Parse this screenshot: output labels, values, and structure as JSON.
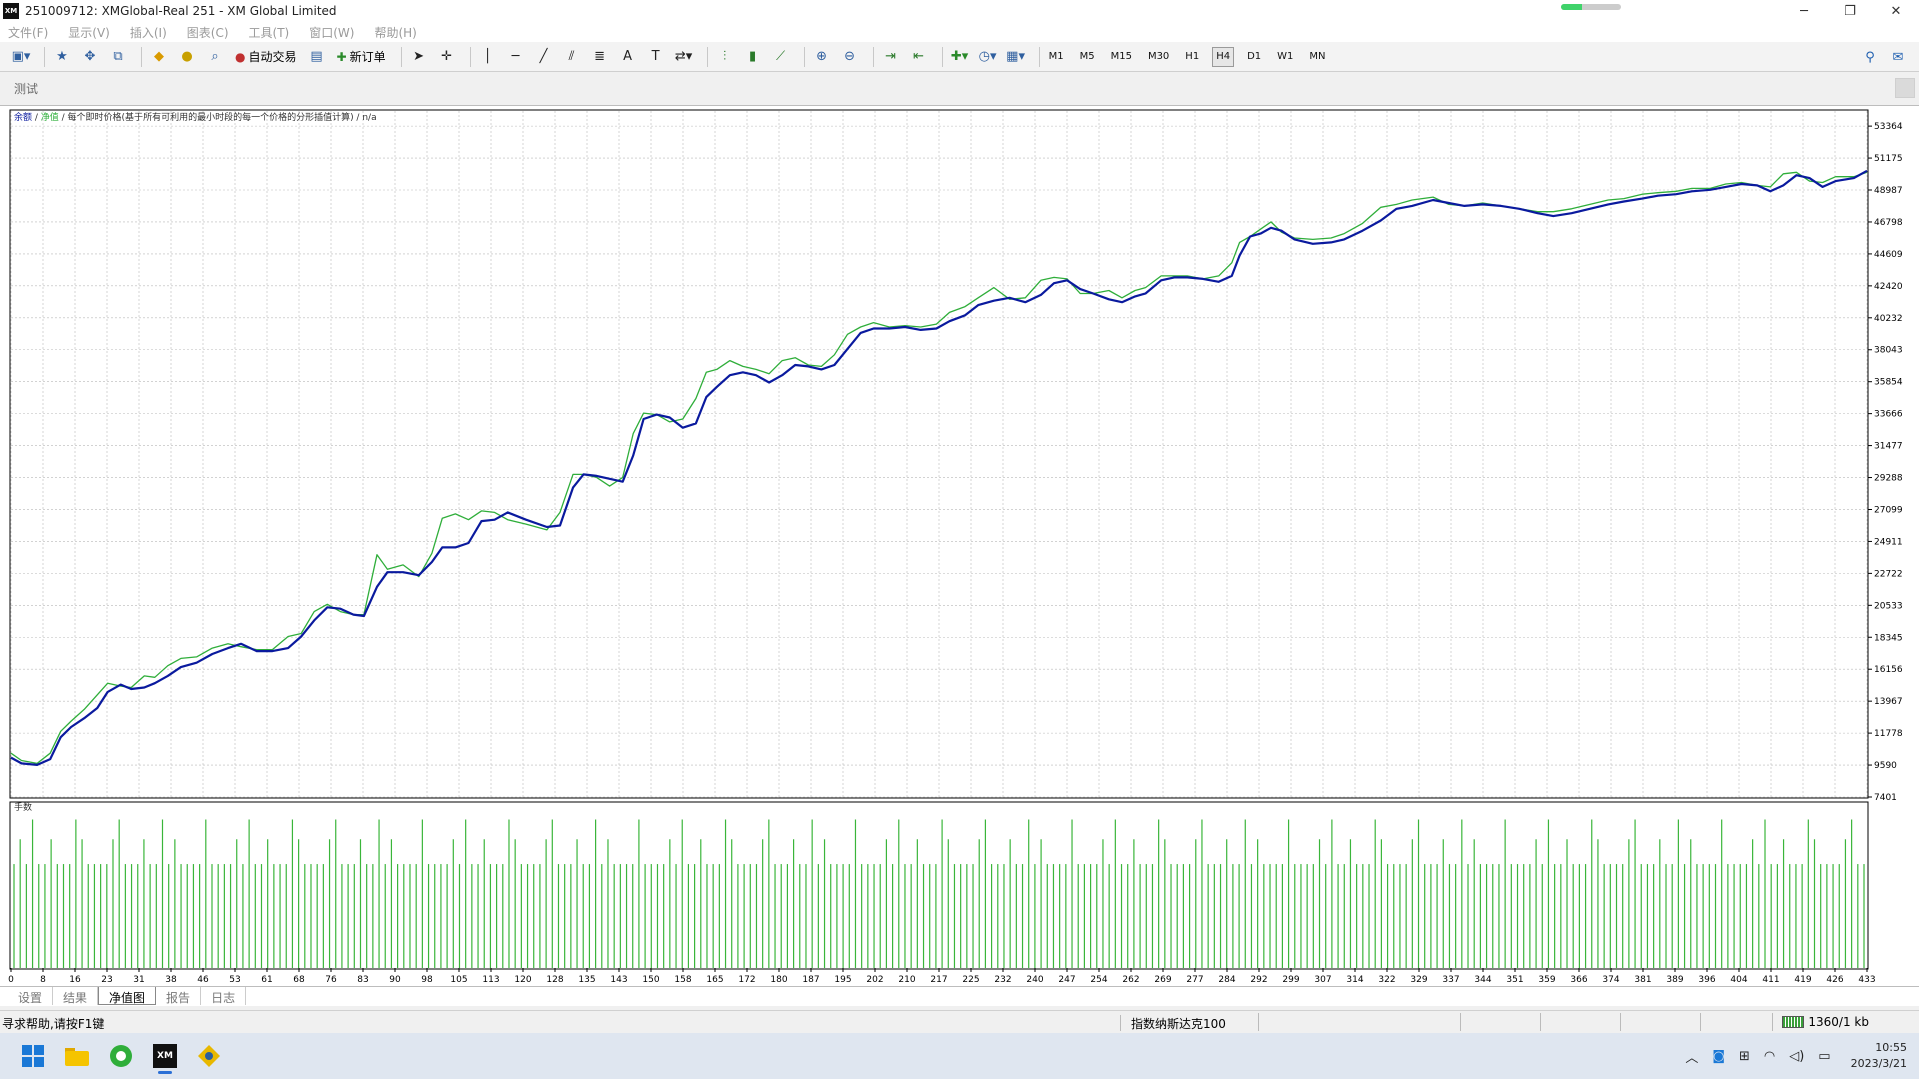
{
  "window": {
    "title": "251009712: XMGlobal-Real 251 - XM Global Limited",
    "logo": "XM",
    "progress_fraction": 0.35,
    "minimize": "─",
    "maximize": "❐",
    "close": "✕"
  },
  "menu": [
    "文件(F)",
    "显示(V)",
    "插入(I)",
    "图表(C)",
    "工具(T)",
    "窗口(W)",
    "帮助(H)"
  ],
  "toolbar": {
    "auto_trade_label": "自动交易",
    "new_order_label": "新订单",
    "timeframes": [
      "M1",
      "M5",
      "M15",
      "M30",
      "H1",
      "H4",
      "D1",
      "W1",
      "MN"
    ],
    "active_timeframe": "H4"
  },
  "panel": {
    "title": "测试"
  },
  "chart_legend": {
    "balance": "余额",
    "sep1": " / ",
    "equity": "净值",
    "rest": " / 每个即时价格(基于所有可利用的最小时段的每一个价格的分形插值计算) / n/a"
  },
  "chart_data": {
    "type": "line",
    "series": [
      {
        "name": "余额",
        "color": "#0a1a9e",
        "points": [
          [
            0,
            10100
          ],
          [
            4,
            9700
          ],
          [
            10,
            9600
          ],
          [
            15,
            10000
          ],
          [
            19,
            11500
          ],
          [
            23,
            12200
          ],
          [
            28,
            12800
          ],
          [
            33,
            13500
          ],
          [
            37,
            14600
          ],
          [
            42,
            15100
          ],
          [
            46,
            14800
          ],
          [
            51,
            14900
          ],
          [
            55,
            15200
          ],
          [
            60,
            15700
          ],
          [
            65,
            16300
          ],
          [
            71,
            16600
          ],
          [
            77,
            17200
          ],
          [
            83,
            17600
          ],
          [
            88,
            17900
          ],
          [
            94,
            17400
          ],
          [
            100,
            17400
          ],
          [
            106,
            17600
          ],
          [
            111,
            18400
          ],
          [
            116,
            19500
          ],
          [
            121,
            20400
          ],
          [
            126,
            20300
          ],
          [
            131,
            19900
          ],
          [
            135,
            19800
          ],
          [
            140,
            21800
          ],
          [
            144,
            22800
          ],
          [
            150,
            22800
          ],
          [
            156,
            22600
          ],
          [
            161,
            23500
          ],
          [
            165,
            24500
          ],
          [
            170,
            24500
          ],
          [
            175,
            24800
          ],
          [
            180,
            26300
          ],
          [
            185,
            26400
          ],
          [
            190,
            26900
          ],
          [
            197,
            26400
          ],
          [
            205,
            25900
          ],
          [
            210,
            26000
          ],
          [
            215,
            28600
          ],
          [
            219,
            29500
          ],
          [
            224,
            29400
          ],
          [
            229,
            29200
          ],
          [
            234,
            29000
          ],
          [
            238,
            30800
          ],
          [
            242,
            33300
          ],
          [
            247,
            33600
          ],
          [
            252,
            33400
          ],
          [
            257,
            32700
          ],
          [
            262,
            33000
          ],
          [
            266,
            34800
          ],
          [
            270,
            35500
          ],
          [
            275,
            36300
          ],
          [
            280,
            36500
          ],
          [
            285,
            36300
          ],
          [
            290,
            35800
          ],
          [
            295,
            36300
          ],
          [
            300,
            37000
          ],
          [
            305,
            36900
          ],
          [
            310,
            36700
          ],
          [
            315,
            37000
          ],
          [
            320,
            38100
          ],
          [
            325,
            39200
          ],
          [
            330,
            39500
          ],
          [
            336,
            39500
          ],
          [
            342,
            39600
          ],
          [
            348,
            39400
          ],
          [
            354,
            39500
          ],
          [
            359,
            40000
          ],
          [
            365,
            40400
          ],
          [
            370,
            41100
          ],
          [
            376,
            41400
          ],
          [
            382,
            41600
          ],
          [
            388,
            41300
          ],
          [
            394,
            41800
          ],
          [
            399,
            42600
          ],
          [
            404,
            42800
          ],
          [
            409,
            42200
          ],
          [
            414,
            41900
          ],
          [
            420,
            41500
          ],
          [
            425,
            41300
          ],
          [
            430,
            41700
          ],
          [
            434,
            41900
          ],
          [
            440,
            42800
          ],
          [
            445,
            43000
          ],
          [
            450,
            43000
          ],
          [
            456,
            42900
          ],
          [
            462,
            42700
          ],
          [
            467,
            43100
          ],
          [
            470,
            44500
          ],
          [
            474,
            45800
          ],
          [
            478,
            46000
          ],
          [
            482,
            46400
          ],
          [
            486,
            46200
          ],
          [
            491,
            45600
          ],
          [
            498,
            45300
          ],
          [
            505,
            45400
          ],
          [
            510,
            45600
          ],
          [
            517,
            46200
          ],
          [
            524,
            46900
          ],
          [
            530,
            47700
          ],
          [
            536,
            47900
          ],
          [
            544,
            48300
          ],
          [
            550,
            48100
          ],
          [
            556,
            47900
          ],
          [
            563,
            48000
          ],
          [
            570,
            47900
          ],
          [
            577,
            47700
          ],
          [
            584,
            47400
          ],
          [
            590,
            47200
          ],
          [
            597,
            47400
          ],
          [
            604,
            47700
          ],
          [
            611,
            48000
          ],
          [
            617,
            48200
          ],
          [
            624,
            48400
          ],
          [
            630,
            48600
          ],
          [
            637,
            48700
          ],
          [
            643,
            48900
          ],
          [
            650,
            49000
          ],
          [
            656,
            49200
          ],
          [
            662,
            49400
          ],
          [
            668,
            49300
          ],
          [
            673,
            48900
          ],
          [
            678,
            49300
          ],
          [
            683,
            50000
          ],
          [
            688,
            49800
          ],
          [
            693,
            49200
          ],
          [
            698,
            49600
          ],
          [
            705,
            49800
          ],
          [
            710,
            50300
          ]
        ]
      },
      {
        "name": "净值",
        "color": "#2fae3a",
        "points": [
          [
            0,
            10400
          ],
          [
            4,
            9900
          ],
          [
            10,
            9700
          ],
          [
            15,
            10400
          ],
          [
            19,
            11900
          ],
          [
            23,
            12600
          ],
          [
            28,
            13400
          ],
          [
            33,
            14400
          ],
          [
            37,
            15200
          ],
          [
            42,
            15000
          ],
          [
            46,
            14900
          ],
          [
            51,
            15700
          ],
          [
            55,
            15600
          ],
          [
            60,
            16400
          ],
          [
            65,
            16900
          ],
          [
            71,
            17000
          ],
          [
            77,
            17600
          ],
          [
            83,
            17900
          ],
          [
            88,
            17700
          ],
          [
            94,
            17500
          ],
          [
            100,
            17500
          ],
          [
            106,
            18400
          ],
          [
            111,
            18600
          ],
          [
            116,
            20100
          ],
          [
            121,
            20600
          ],
          [
            126,
            20100
          ],
          [
            131,
            19900
          ],
          [
            135,
            19900
          ],
          [
            140,
            24000
          ],
          [
            144,
            23000
          ],
          [
            150,
            23300
          ],
          [
            156,
            22500
          ],
          [
            161,
            24100
          ],
          [
            165,
            26500
          ],
          [
            170,
            26800
          ],
          [
            175,
            26400
          ],
          [
            180,
            27000
          ],
          [
            185,
            26900
          ],
          [
            190,
            26400
          ],
          [
            197,
            26100
          ],
          [
            205,
            25700
          ],
          [
            210,
            26900
          ],
          [
            215,
            29500
          ],
          [
            219,
            29500
          ],
          [
            224,
            29300
          ],
          [
            229,
            28700
          ],
          [
            234,
            29300
          ],
          [
            238,
            32300
          ],
          [
            242,
            33700
          ],
          [
            247,
            33600
          ],
          [
            252,
            33100
          ],
          [
            257,
            33300
          ],
          [
            262,
            34700
          ],
          [
            266,
            36500
          ],
          [
            270,
            36700
          ],
          [
            275,
            37300
          ],
          [
            280,
            36900
          ],
          [
            285,
            36700
          ],
          [
            290,
            36400
          ],
          [
            295,
            37300
          ],
          [
            300,
            37500
          ],
          [
            305,
            37000
          ],
          [
            310,
            36900
          ],
          [
            315,
            37700
          ],
          [
            320,
            39100
          ],
          [
            325,
            39600
          ],
          [
            330,
            39900
          ],
          [
            336,
            39600
          ],
          [
            342,
            39700
          ],
          [
            348,
            39600
          ],
          [
            354,
            39800
          ],
          [
            359,
            40600
          ],
          [
            365,
            41000
          ],
          [
            370,
            41600
          ],
          [
            376,
            42300
          ],
          [
            382,
            41500
          ],
          [
            388,
            41600
          ],
          [
            394,
            42800
          ],
          [
            399,
            43000
          ],
          [
            404,
            42900
          ],
          [
            409,
            41900
          ],
          [
            414,
            41900
          ],
          [
            420,
            42100
          ],
          [
            425,
            41600
          ],
          [
            430,
            42100
          ],
          [
            434,
            42300
          ],
          [
            440,
            43100
          ],
          [
            445,
            43100
          ],
          [
            450,
            43100
          ],
          [
            456,
            42900
          ],
          [
            462,
            43100
          ],
          [
            467,
            44000
          ],
          [
            470,
            45400
          ],
          [
            474,
            45800
          ],
          [
            478,
            46300
          ],
          [
            482,
            46800
          ],
          [
            486,
            46100
          ],
          [
            491,
            45700
          ],
          [
            498,
            45600
          ],
          [
            505,
            45700
          ],
          [
            510,
            46000
          ],
          [
            517,
            46700
          ],
          [
            524,
            47800
          ],
          [
            530,
            48000
          ],
          [
            536,
            48300
          ],
          [
            544,
            48500
          ],
          [
            550,
            48000
          ],
          [
            556,
            47900
          ],
          [
            563,
            48100
          ],
          [
            570,
            47900
          ],
          [
            577,
            47700
          ],
          [
            584,
            47500
          ],
          [
            590,
            47500
          ],
          [
            597,
            47700
          ],
          [
            604,
            48000
          ],
          [
            611,
            48300
          ],
          [
            617,
            48400
          ],
          [
            624,
            48700
          ],
          [
            630,
            48800
          ],
          [
            637,
            48900
          ],
          [
            643,
            49100
          ],
          [
            650,
            49100
          ],
          [
            656,
            49400
          ],
          [
            662,
            49500
          ],
          [
            668,
            49300
          ],
          [
            673,
            49200
          ],
          [
            678,
            50100
          ],
          [
            683,
            50200
          ],
          [
            688,
            49600
          ],
          [
            693,
            49500
          ],
          [
            698,
            49900
          ],
          [
            705,
            49900
          ],
          [
            710,
            50200
          ]
        ]
      }
    ],
    "x_range": [
      0,
      710
    ],
    "x_tick_labels": [
      "0",
      "8",
      "16",
      "23",
      "31",
      "38",
      "46",
      "53",
      "61",
      "68",
      "76",
      "83",
      "90",
      "98",
      "105",
      "113",
      "120",
      "128",
      "135",
      "143",
      "150",
      "158",
      "165",
      "172",
      "180",
      "187",
      "195",
      "202",
      "210",
      "217",
      "225",
      "232",
      "240",
      "247",
      "254",
      "262",
      "269",
      "277",
      "284",
      "292",
      "299",
      "307",
      "314",
      "322",
      "329",
      "337",
      "344",
      "351",
      "359",
      "366",
      "374",
      "381",
      "389",
      "396",
      "404",
      "411",
      "419",
      "426",
      "433"
    ],
    "y_range": [
      7401,
      54400
    ],
    "y_tick_values": [
      53364,
      51175,
      48987,
      46798,
      44609,
      42420,
      40232,
      38043,
      35854,
      33666,
      31477,
      29288,
      27099,
      24911,
      22722,
      20533,
      18345,
      16156,
      13967,
      11778,
      9590,
      7401
    ],
    "grid": true,
    "volume_panel": {
      "label": "手数",
      "color": "#3ab53a",
      "bar_count": 300,
      "tall_level": 0.9,
      "high_level": 0.78,
      "normal_level": 0.63,
      "tall_every": 7,
      "high_every": 5
    }
  },
  "tabs": [
    "设置",
    "结果",
    "净值图",
    "报告",
    "日志"
  ],
  "active_tab": "净值图",
  "status": {
    "help": "寻求帮助,请按F1键",
    "profile": "指数纳斯达克100",
    "traffic": "1360/1 kb"
  },
  "taskbar": {
    "apps": [
      "start",
      "file-explorer",
      "browser",
      "xm-terminal",
      "trading-app"
    ],
    "xm_label": "XM",
    "tray_up": "︿",
    "time": "10:55",
    "date": "2023/3/21"
  }
}
